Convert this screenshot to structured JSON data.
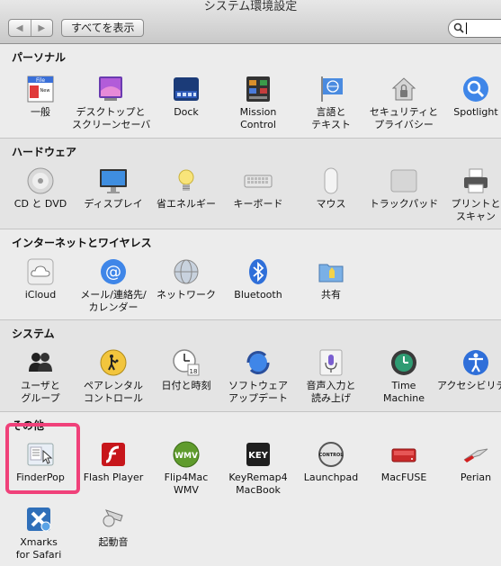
{
  "window": {
    "title": "システム環境設定"
  },
  "toolbar": {
    "back_icon": "◀",
    "forward_icon": "▶",
    "show_all_label": "すべてを表示",
    "search_value": ""
  },
  "sections": [
    {
      "title": "パーソナル",
      "items": [
        {
          "label1": "一般",
          "label2": ""
        },
        {
          "label1": "デスクトップと",
          "label2": "スクリーンセーバ"
        },
        {
          "label1": "Dock",
          "label2": ""
        },
        {
          "label1": "Mission",
          "label2": "Control"
        },
        {
          "label1": "言語と",
          "label2": "テキスト"
        },
        {
          "label1": "セキュリティと",
          "label2": "プライバシー"
        },
        {
          "label1": "Spotlight",
          "label2": ""
        }
      ]
    },
    {
      "title": "ハードウェア",
      "items": [
        {
          "label1": "CD と DVD",
          "label2": ""
        },
        {
          "label1": "ディスプレイ",
          "label2": ""
        },
        {
          "label1": "省エネルギー",
          "label2": ""
        },
        {
          "label1": "キーボード",
          "label2": ""
        },
        {
          "label1": "マウス",
          "label2": ""
        },
        {
          "label1": "トラックパッド",
          "label2": ""
        },
        {
          "label1": "プリントと",
          "label2": "スキャン"
        }
      ]
    },
    {
      "title": "インターネットとワイヤレス",
      "items": [
        {
          "label1": "iCloud",
          "label2": ""
        },
        {
          "label1": "メール/連絡先/",
          "label2": "カレンダー"
        },
        {
          "label1": "ネットワーク",
          "label2": ""
        },
        {
          "label1": "Bluetooth",
          "label2": ""
        },
        {
          "label1": "共有",
          "label2": ""
        }
      ]
    },
    {
      "title": "システム",
      "items": [
        {
          "label1": "ユーザと",
          "label2": "グループ"
        },
        {
          "label1": "ペアレンタル",
          "label2": "コントロール"
        },
        {
          "label1": "日付と時刻",
          "label2": ""
        },
        {
          "label1": "ソフトウェア",
          "label2": "アップデート"
        },
        {
          "label1": "音声入力と",
          "label2": "読み上げ"
        },
        {
          "label1": "Time",
          "label2": "Machine"
        },
        {
          "label1": "アクセシビリティ",
          "label2": ""
        }
      ]
    },
    {
      "title": "その他",
      "items": [
        {
          "label1": "FinderPop",
          "label2": ""
        },
        {
          "label1": "Flash Player",
          "label2": ""
        },
        {
          "label1": "Flip4Mac",
          "label2": "WMV"
        },
        {
          "label1": "KeyRemap4",
          "label2": "MacBook"
        },
        {
          "label1": "Launchpad",
          "label2": ""
        },
        {
          "label1": "MacFUSE",
          "label2": ""
        },
        {
          "label1": "Perian",
          "label2": ""
        },
        {
          "label1": "Xmarks",
          "label2": "for Safari"
        },
        {
          "label1": "起動音",
          "label2": ""
        }
      ]
    }
  ],
  "icon_text": {
    "general_file": "File",
    "general_new": "New",
    "date_day": "18",
    "wmv": "WMV",
    "key": "KEY",
    "control": "CONTROL"
  },
  "colors": {
    "highlight": "#f0417a"
  }
}
